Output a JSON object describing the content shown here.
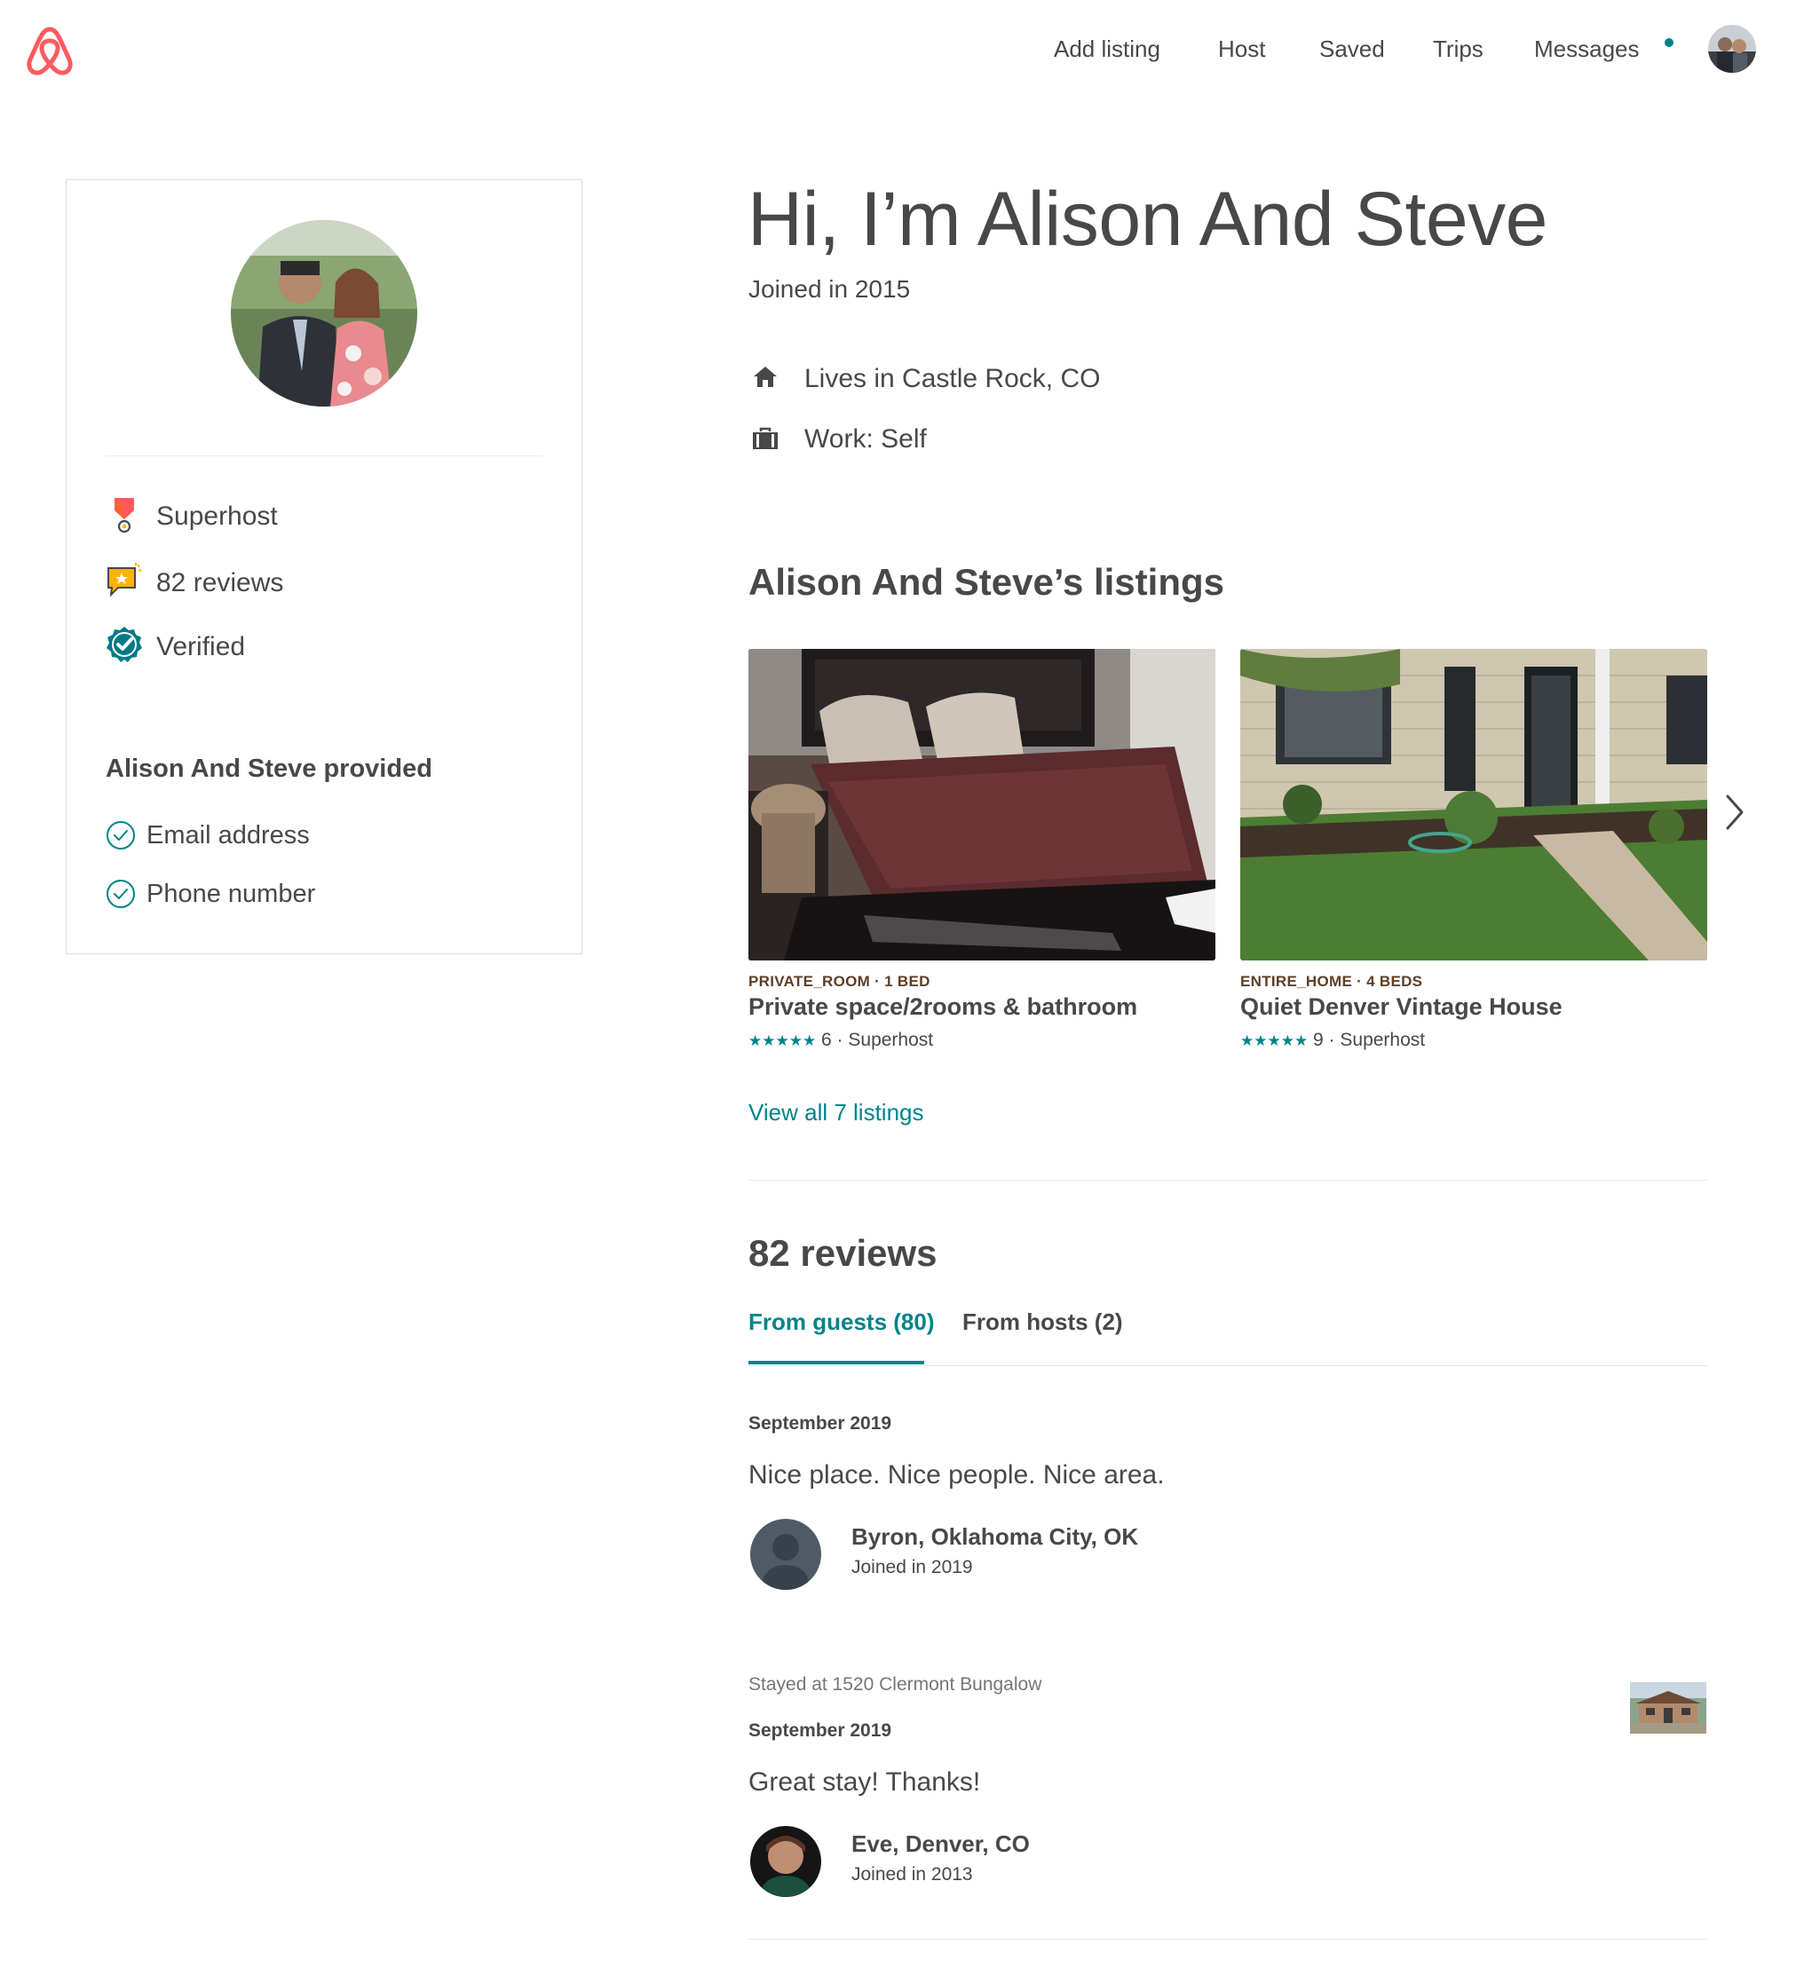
{
  "header": {
    "nav": [
      {
        "label": "Add listing"
      },
      {
        "label": "Host"
      },
      {
        "label": "Saved"
      },
      {
        "label": "Trips"
      },
      {
        "label": "Messages"
      }
    ],
    "messages_unread": true
  },
  "profile": {
    "badges": [
      {
        "icon": "superhost-medal-icon",
        "label": "Superhost"
      },
      {
        "icon": "reviews-bubble-icon",
        "label": "82 reviews"
      },
      {
        "icon": "verified-badge-icon",
        "label": "Verified"
      }
    ],
    "provided_title": "Alison And Steve provided",
    "provided": [
      {
        "icon": "check-circle-icon",
        "label": "Email address"
      },
      {
        "icon": "check-circle-icon",
        "label": "Phone number"
      }
    ]
  },
  "main": {
    "title": "Hi, I’m Alison And Steve",
    "joined": "Joined in 2015",
    "info": [
      {
        "icon": "home-icon",
        "label": "Lives in Castle Rock, CO"
      },
      {
        "icon": "briefcase-icon",
        "label": "Work: Self"
      }
    ],
    "listings_heading": "Alison And Steve’s listings",
    "listings": [
      {
        "kicker": "PRIVATE_ROOM · 1 BED",
        "title": "Private space/2rooms & bathroom",
        "stars": "★★★★★",
        "meta": " 6 · Superhost"
      },
      {
        "kicker": "ENTIRE_HOME · 4 BEDS",
        "title": "Quiet Denver Vintage House",
        "stars": "★★★★★",
        "meta": " 9 · Superhost"
      }
    ],
    "view_all": "View all 7 listings",
    "reviews_heading": "82 reviews",
    "tabs": [
      {
        "label": "From guests (80)",
        "active": true
      },
      {
        "label": "From hosts (2)",
        "active": false
      }
    ],
    "reviews": [
      {
        "stayed_at": "",
        "date": "September 2019",
        "text": "Nice place. Nice people. Nice area.",
        "name": "Byron, Oklahoma City, OK",
        "joined": "Joined in 2019"
      },
      {
        "stayed_at": "Stayed at 1520 Clermont Bungalow",
        "date": "September 2019",
        "text": "Great stay! Thanks!",
        "name": "Eve, Denver, CO",
        "joined": "Joined in 2013"
      }
    ]
  },
  "colors": {
    "brand": "#FF5A5F",
    "accent": "#00848A",
    "text": "#484848",
    "kicker": "#5C3F28",
    "border": "#DDDDDD"
  }
}
